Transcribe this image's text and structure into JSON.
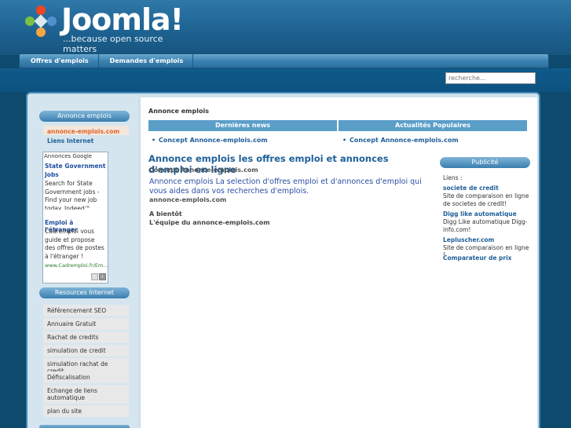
{
  "header": {
    "logo_word": "Joomla!",
    "tagline": "...because open source matters"
  },
  "nav": {
    "items": [
      "Offres d'emplois",
      "Demandes d'emplois"
    ]
  },
  "search": {
    "placeholder": "recherche..."
  },
  "left": {
    "module1_title": "Annonce emplois",
    "module1_items": [
      "annonce-emplois.com",
      "Liens Internet"
    ],
    "ads": {
      "label": "Annonces Google",
      "ad1_title": "State Government Jobs",
      "ad1_text": "Search for State Government jobs - Find your new job today. Indeed™",
      "ad2_title": "Emploi à l'étranger",
      "ad2_text": "Cadremploi vous guide et propose des offres de postes à l'étranger !",
      "ad2_url": "www.Cadremploi.fr/Em..."
    },
    "module2_title": "Resources Internet",
    "module2_items": [
      "Référencement SEO",
      "Annuaire Gratuit",
      "Rachat de credits",
      "simulation de credit",
      "simulation rachat de credit",
      "Défiscalisation",
      "Echange de liens automatique",
      "plan du site"
    ]
  },
  "main": {
    "breadcrumb": "Annonce emplois",
    "bar_left": "Dernières news",
    "bar_right": "Actualités Populaires",
    "news_left": "Concept Annonce-emplois.com",
    "news_right": "Concept Annonce-emplois.com",
    "title": "Annonce emplois les offres emploi et annonces d'emploi en ligne",
    "subtitle": "Concept Annonce-emplois.com",
    "intro": "Annonce emplois La selection d'offres emploi et d'annonces d'emploi qui vous aides dans vos recherches d'emplois.",
    "site": "annonce-emplois.com",
    "bye": "A bientôt",
    "team": "L'équipe du annonce-emplois.com"
  },
  "right": {
    "title": "Publicité",
    "liens_label": "Liens :",
    "items": [
      {
        "title": "societe de credit",
        "text": "Site de comparaison en ligne de societes de credit!"
      },
      {
        "title": "Digg like automatique",
        "text": "Digg Like automatique Digg-info.com!"
      },
      {
        "title": "Lepluscher.com",
        "text": "Site de comparaison en ligne !"
      },
      {
        "title": "Comparateur de prix",
        "text": ""
      }
    ]
  }
}
